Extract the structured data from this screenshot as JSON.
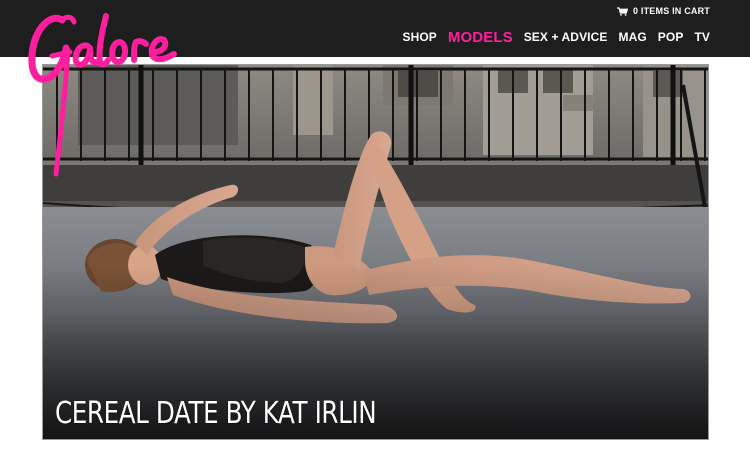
{
  "brand": {
    "logo_text": "Galore",
    "accent_color": "#ff1e9e",
    "bar_color": "#1e1e1f"
  },
  "header": {
    "cart": {
      "icon": "cart-icon",
      "label": "0 ITEMS IN CART"
    },
    "nav": [
      {
        "label": "SHOP",
        "active": false
      },
      {
        "label": "MODELS",
        "active": true
      },
      {
        "label": "SEX + ADVICE",
        "active": false
      },
      {
        "label": "MAG",
        "active": false
      },
      {
        "label": "POP",
        "active": false
      },
      {
        "label": "TV",
        "active": false
      }
    ]
  },
  "hero": {
    "caption": "CEREAL DATE BY KAT IRLIN"
  }
}
